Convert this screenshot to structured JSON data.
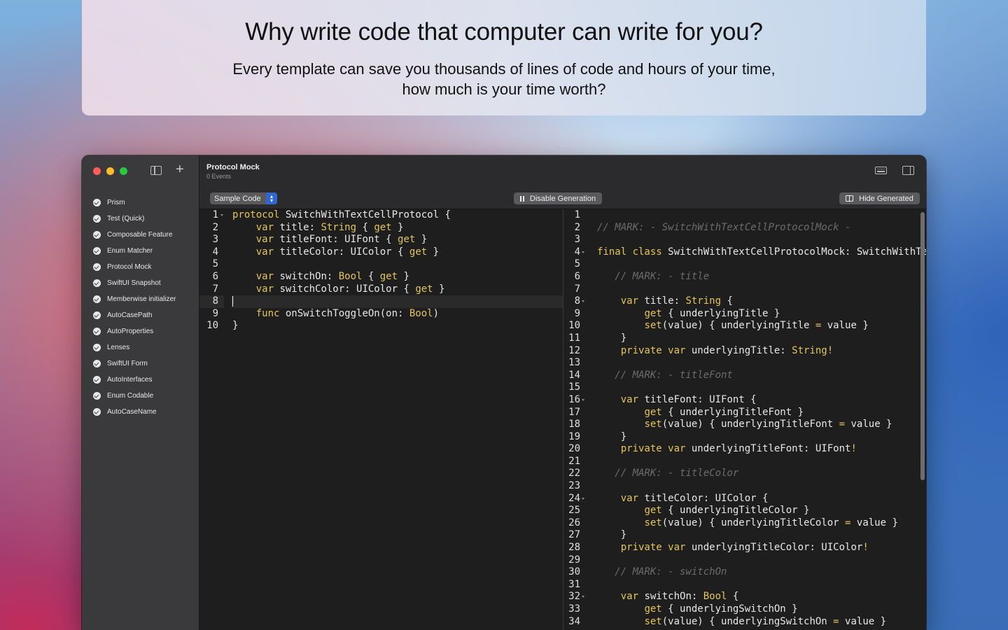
{
  "headline": {
    "title": "Why write code that computer can write for you?",
    "line1": "Every template can save you thousands of lines of code and hours of your time,",
    "line2": "how much is your time worth?"
  },
  "sidebar": {
    "items": [
      {
        "label": "Prism"
      },
      {
        "label": "Test (Quick)"
      },
      {
        "label": "Composable Feature"
      },
      {
        "label": "Enum Matcher"
      },
      {
        "label": "Protocol Mock"
      },
      {
        "label": "SwiftUI Snapshot"
      },
      {
        "label": "Memberwise initializer"
      },
      {
        "label": "AutoCasePath"
      },
      {
        "label": "AutoProperties"
      },
      {
        "label": "Lenses"
      },
      {
        "label": "SwiftUI Form"
      },
      {
        "label": "AutoInterfaces"
      },
      {
        "label": "Enum Codable"
      },
      {
        "label": "AutoCaseName"
      }
    ]
  },
  "document": {
    "title": "Protocol Mock",
    "subtitle": "0 Events"
  },
  "toolbar": {
    "sample_label": "Sample Code",
    "disable_label": "Disable Generation",
    "hide_label": "Hide Generated"
  },
  "source_code": {
    "active_line": 8,
    "lines": [
      [
        [
          "kw",
          "protocol"
        ],
        [
          "pl",
          " SwitchWithTextCellProtocol {"
        ]
      ],
      [
        [
          "pl",
          "    "
        ],
        [
          "kw",
          "var"
        ],
        [
          "pl",
          " title: "
        ],
        [
          "ty",
          "String"
        ],
        [
          "pl",
          " { "
        ],
        [
          "kw",
          "get"
        ],
        [
          "pl",
          " }"
        ]
      ],
      [
        [
          "pl",
          "    "
        ],
        [
          "kw",
          "var"
        ],
        [
          "pl",
          " titleFont: UIFont { "
        ],
        [
          "kw",
          "get"
        ],
        [
          "pl",
          " }"
        ]
      ],
      [
        [
          "pl",
          "    "
        ],
        [
          "kw",
          "var"
        ],
        [
          "pl",
          " titleColor: UIColor { "
        ],
        [
          "kw",
          "get"
        ],
        [
          "pl",
          " }"
        ]
      ],
      [],
      [
        [
          "pl",
          "    "
        ],
        [
          "kw",
          "var"
        ],
        [
          "pl",
          " switchOn: "
        ],
        [
          "ty",
          "Bool"
        ],
        [
          "pl",
          " { "
        ],
        [
          "kw",
          "get"
        ],
        [
          "pl",
          " }"
        ]
      ],
      [
        [
          "pl",
          "    "
        ],
        [
          "kw",
          "var"
        ],
        [
          "pl",
          " switchColor: UIColor { "
        ],
        [
          "kw",
          "get"
        ],
        [
          "pl",
          " }"
        ]
      ],
      [],
      [
        [
          "pl",
          "    "
        ],
        [
          "kw",
          "func"
        ],
        [
          "pl",
          " onSwitchToggleOn(on: "
        ],
        [
          "ty",
          "Bool"
        ],
        [
          "pl",
          ")"
        ]
      ],
      [
        [
          "pl",
          "}"
        ]
      ]
    ],
    "fold_lines": [
      1
    ]
  },
  "generated_code": {
    "lines": [
      [],
      [
        [
          "cm",
          "// MARK: - SwitchWithTextCellProtocolMock -"
        ]
      ],
      [],
      [
        [
          "kw",
          "final class"
        ],
        [
          "pl",
          " SwitchWithTextCellProtocolMock: SwitchWithTextCellProtocol {"
        ]
      ],
      [],
      [
        [
          "cm",
          "   // MARK: - title"
        ]
      ],
      [],
      [
        [
          "pl",
          "    "
        ],
        [
          "kw",
          "var"
        ],
        [
          "pl",
          " title: "
        ],
        [
          "ty",
          "String"
        ],
        [
          "pl",
          " {"
        ]
      ],
      [
        [
          "pl",
          "        "
        ],
        [
          "kw",
          "get"
        ],
        [
          "pl",
          " { underlyingTitle }"
        ]
      ],
      [
        [
          "pl",
          "        "
        ],
        [
          "kw",
          "set"
        ],
        [
          "pl",
          "(value) { underlyingTitle "
        ],
        [
          "kw",
          "="
        ],
        [
          "pl",
          " value }"
        ]
      ],
      [
        [
          "pl",
          "    }"
        ]
      ],
      [
        [
          "pl",
          "    "
        ],
        [
          "kw",
          "private var"
        ],
        [
          "pl",
          " underlyingTitle: "
        ],
        [
          "ty",
          "String"
        ],
        [
          "kw",
          "!"
        ]
      ],
      [],
      [
        [
          "cm",
          "   // MARK: - titleFont"
        ]
      ],
      [],
      [
        [
          "pl",
          "    "
        ],
        [
          "kw",
          "var"
        ],
        [
          "pl",
          " titleFont: UIFont {"
        ]
      ],
      [
        [
          "pl",
          "        "
        ],
        [
          "kw",
          "get"
        ],
        [
          "pl",
          " { underlyingTitleFont }"
        ]
      ],
      [
        [
          "pl",
          "        "
        ],
        [
          "kw",
          "set"
        ],
        [
          "pl",
          "(value) { underlyingTitleFont "
        ],
        [
          "kw",
          "="
        ],
        [
          "pl",
          " value }"
        ]
      ],
      [
        [
          "pl",
          "    }"
        ]
      ],
      [
        [
          "pl",
          "    "
        ],
        [
          "kw",
          "private var"
        ],
        [
          "pl",
          " underlyingTitleFont: UIFont"
        ],
        [
          "kw",
          "!"
        ]
      ],
      [],
      [
        [
          "cm",
          "   // MARK: - titleColor"
        ]
      ],
      [],
      [
        [
          "pl",
          "    "
        ],
        [
          "kw",
          "var"
        ],
        [
          "pl",
          " titleColor: UIColor {"
        ]
      ],
      [
        [
          "pl",
          "        "
        ],
        [
          "kw",
          "get"
        ],
        [
          "pl",
          " { underlyingTitleColor }"
        ]
      ],
      [
        [
          "pl",
          "        "
        ],
        [
          "kw",
          "set"
        ],
        [
          "pl",
          "(value) { underlyingTitleColor "
        ],
        [
          "kw",
          "="
        ],
        [
          "pl",
          " value }"
        ]
      ],
      [
        [
          "pl",
          "    }"
        ]
      ],
      [
        [
          "pl",
          "    "
        ],
        [
          "kw",
          "private var"
        ],
        [
          "pl",
          " underlyingTitleColor: UIColor"
        ],
        [
          "kw",
          "!"
        ]
      ],
      [],
      [
        [
          "cm",
          "   // MARK: - switchOn"
        ]
      ],
      [],
      [
        [
          "pl",
          "    "
        ],
        [
          "kw",
          "var"
        ],
        [
          "pl",
          " switchOn: "
        ],
        [
          "ty",
          "Bool"
        ],
        [
          "pl",
          " {"
        ]
      ],
      [
        [
          "pl",
          "        "
        ],
        [
          "kw",
          "get"
        ],
        [
          "pl",
          " { underlyingSwitchOn }"
        ]
      ],
      [
        [
          "pl",
          "        "
        ],
        [
          "kw",
          "set"
        ],
        [
          "pl",
          "(value) { underlyingSwitchOn "
        ],
        [
          "kw",
          "="
        ],
        [
          "pl",
          " value }"
        ]
      ]
    ],
    "fold_lines": [
      4,
      8,
      16,
      24,
      32
    ]
  },
  "colors": {
    "keyword": "#e5c65b",
    "comment": "#6c6c6c",
    "accent": "#2f66d0",
    "editor_bg": "#1e1e1e",
    "sidebar_bg": "#3a3a3c"
  }
}
